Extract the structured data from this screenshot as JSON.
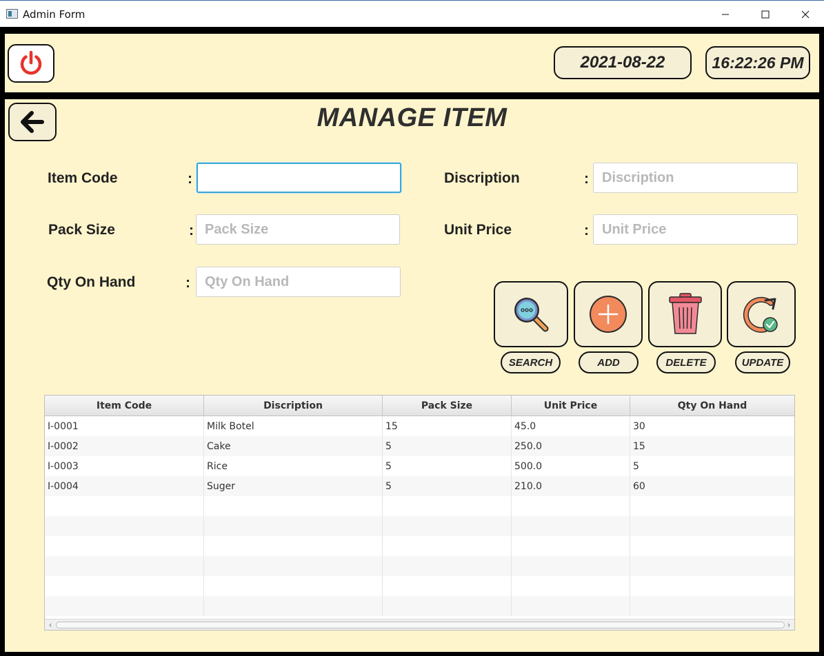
{
  "window": {
    "title": "Admin Form"
  },
  "header": {
    "date": "2021-08-22",
    "time": "16:22:26 PM"
  },
  "page": {
    "title": "MANAGE ITEM"
  },
  "form": {
    "item_code": {
      "label": "Item Code",
      "value": "",
      "placeholder": ""
    },
    "description": {
      "label": "Discription",
      "value": "",
      "placeholder": "Discription"
    },
    "pack_size": {
      "label": "Pack Size",
      "value": "",
      "placeholder": "Pack Size"
    },
    "unit_price": {
      "label": "Unit Price",
      "value": "",
      "placeholder": "Unit Price"
    },
    "qty_on_hand": {
      "label": "Qty On Hand",
      "value": "",
      "placeholder": "Qty On Hand"
    },
    "colon": ":"
  },
  "actions": {
    "search_label": "SEARCH",
    "add_label": "ADD",
    "delete_label": "DELETE",
    "update_label": "UPDATE"
  },
  "icons": {
    "power": "power-icon",
    "back": "arrow-left-icon",
    "search": "magnifier-icon",
    "add": "plus-circle-icon",
    "delete": "trash-icon",
    "update": "refresh-check-icon"
  },
  "colors": {
    "background": "#fff5cc",
    "power_red": "#e8332b",
    "focus_blue": "#3aa7d4"
  },
  "table": {
    "headers": [
      "Item Code",
      "Discription",
      "Pack Size",
      "Unit Price",
      "Qty On Hand"
    ],
    "rows": [
      [
        "I-0001",
        "Milk Botel",
        "15",
        "45.0",
        "30"
      ],
      [
        "I-0002",
        "Cake",
        "5",
        "250.0",
        "15"
      ],
      [
        "I-0003",
        "Rice",
        "5",
        "500.0",
        "5"
      ],
      [
        "I-0004",
        "Suger",
        "5",
        "210.0",
        "60"
      ],
      [
        "",
        "",
        "",
        "",
        ""
      ],
      [
        "",
        "",
        "",
        "",
        ""
      ],
      [
        "",
        "",
        "",
        "",
        ""
      ],
      [
        "",
        "",
        "",
        "",
        ""
      ],
      [
        "",
        "",
        "",
        "",
        ""
      ],
      [
        "",
        "",
        "",
        "",
        ""
      ]
    ],
    "scroll_left": "‹",
    "scroll_right": "›"
  }
}
